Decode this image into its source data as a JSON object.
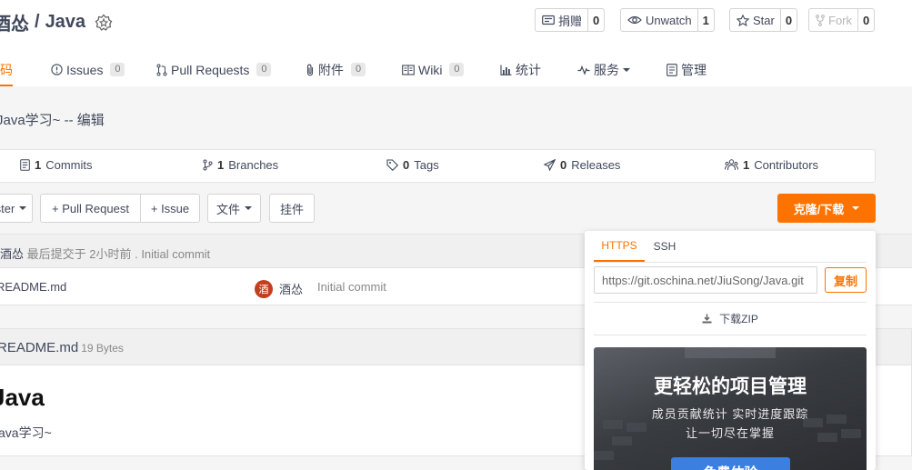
{
  "repo": {
    "owner": "酒怂",
    "separator": "/",
    "name": "Java"
  },
  "header_buttons": {
    "donate": {
      "label": "捐赠",
      "count": "0"
    },
    "unwatch": {
      "label": "Unwatch",
      "count": "1"
    },
    "star": {
      "label": "Star",
      "count": "0"
    },
    "fork": {
      "label": "Fork",
      "count": "0"
    }
  },
  "tabs": [
    {
      "label": "代码",
      "active": true
    },
    {
      "label": "Issues",
      "count": "0"
    },
    {
      "label": "Pull Requests",
      "count": "0"
    },
    {
      "label": "附件",
      "count": "0"
    },
    {
      "label": "Wiki",
      "count": "0"
    },
    {
      "label": "统计"
    },
    {
      "label": "服务"
    },
    {
      "label": "管理"
    }
  ],
  "description": "Java学习~ -- 编辑",
  "stats": {
    "commits": {
      "count": "1",
      "label": "Commits"
    },
    "branches": {
      "count": "1",
      "label": "Branches"
    },
    "tags": {
      "count": "0",
      "label": "Tags"
    },
    "releases": {
      "count": "0",
      "label": "Releases"
    },
    "contributors": {
      "count": "1",
      "label": "Contributors"
    }
  },
  "toolbar": {
    "branch": "master",
    "pull_request": "+ Pull Request",
    "issue": "+ Issue",
    "files": "文件",
    "widget": "挂件",
    "clone": "克隆/下载"
  },
  "commit": {
    "author": "酒怂",
    "text": "最后提交于 2小时前 . Initial commit"
  },
  "files": [
    {
      "name": "README.md",
      "avatar": "酒",
      "author": "酒怂",
      "message": "Initial commit"
    }
  ],
  "readme": {
    "filename": "README.md",
    "size": "19 Bytes",
    "heading": "Java",
    "body": "Java学习~"
  },
  "clone_popup": {
    "tab_https": "HTTPS",
    "tab_ssh": "SSH",
    "url": "https://git.oschina.net/JiuSong/Java.git",
    "copy": "复制",
    "download_zip": "下载ZIP",
    "promo": {
      "title": "更轻松的项目管理",
      "line1": "成员贡献统计   实时进度跟踪",
      "line2": "让一切尽在掌握",
      "button": "免费体验"
    }
  },
  "colors": {
    "accent": "#fe7300",
    "text": "#40485b",
    "promo_button": "#3b7fe0"
  }
}
